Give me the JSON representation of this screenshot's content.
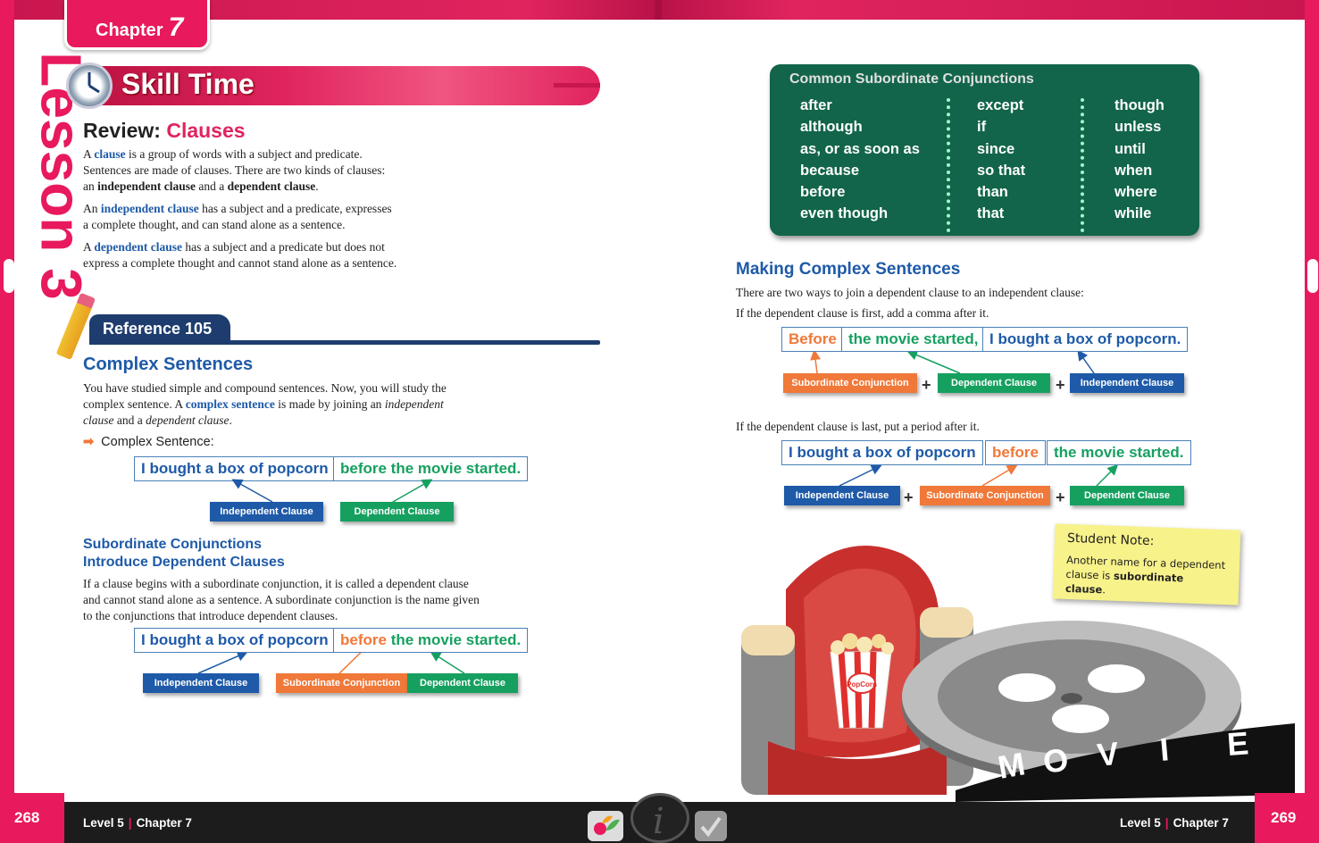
{
  "chapter": {
    "label": "Chapter",
    "number": "7"
  },
  "lesson_side": "Lesson 3",
  "skill_time": "Skill Time",
  "review": {
    "prefix": "Review: ",
    "topic": "Clauses"
  },
  "review_paras": [
    {
      "a": "A ",
      "k": "clause",
      "b": " is a group of words with a subject and predicate.",
      "c": "Sentences are made of clauses. There are two kinds of clauses:",
      "d1": "an ",
      "dk1": "independent clause",
      "d2": " and a ",
      "dk2": "dependent clause",
      "d3": "."
    },
    {
      "a": "An ",
      "k": "independent clause",
      "b": " has a subject and a predicate, expresses",
      "c": "a complete thought, and can stand alone as a sentence."
    },
    {
      "a": "A ",
      "k": "dependent clause",
      "b": " has a subject and a predicate but does not",
      "c": "express a complete thought and cannot stand alone as a sentence."
    }
  ],
  "reference": "Reference 105",
  "complex": {
    "title": "Complex Sentences",
    "p1": "You have studied simple and compound sentences. Now, you will study the",
    "p2a": "complex sentence. A ",
    "p2k": "complex sentence",
    "p2b": " is made by joining an ",
    "p2i": "independent",
    "p3i": "clause",
    "p3a": " and a ",
    "p3i2": "dependent clause",
    "p3b": ".",
    "bullet": "Complex Sentence:"
  },
  "example1": {
    "independent": "I bought a box of popcorn",
    "dependent": "before the movie started."
  },
  "labels": {
    "independent": "Independent Clause",
    "dependent": "Dependent Clause",
    "subordinate": "Subordinate Conjunction",
    "plus": "+"
  },
  "subconj": {
    "title1": "Subordinate Conjunctions",
    "title2": "Introduce Dependent Clauses",
    "p1": "If a clause begins with a subordinate conjunction, it is called a dependent clause",
    "p2": "and cannot stand alone as a sentence. A subordinate conjunction is the name given",
    "p3": "to the conjunctions that introduce dependent clauses."
  },
  "example2": {
    "independent": "I bought a box of popcorn",
    "conj": "before",
    "rest": " the movie started."
  },
  "conj_table": {
    "title": "Common Subordinate Conjunctions",
    "col1": [
      "after",
      "although",
      "as, or as soon as",
      "because",
      "before",
      "even though"
    ],
    "col2": [
      "except",
      "if",
      "since",
      "so that",
      "than",
      "that"
    ],
    "col3": [
      "though",
      "unless",
      "until",
      "when",
      "where",
      "while"
    ]
  },
  "making": {
    "title": "Making Complex Sentences",
    "p1": "There are two ways to join a dependent clause to an independent clause:",
    "p2": "If the dependent clause is first, add a comma after it.",
    "p3": "If the dependent clause is last, put a period after it."
  },
  "example3": {
    "conj": "Before",
    "dependent": "the movie started,",
    "independent": "I bought a box of popcorn."
  },
  "example4": {
    "independent": "I bought a box of popcorn",
    "conj": "before",
    "dependent": "the movie started."
  },
  "sticky": {
    "title": "Student Note:",
    "body1": "Another name for a dependent",
    "body2a": "clause is ",
    "body2b": "subordinate clause",
    "body2c": "."
  },
  "popcorn_brand": "PopCorn",
  "movie_letters": [
    "M",
    "O",
    "V",
    "I",
    "E"
  ],
  "footer": {
    "left_page": "268",
    "right_page": "269",
    "level": "Level 5",
    "chapter": "Chapter 7"
  },
  "colors": {
    "magenta": "#e8195c",
    "blue": "#1e5aa8",
    "green": "#16a060",
    "orange": "#f07838",
    "table_green": "#12654a",
    "navy": "#1e3d6e"
  }
}
